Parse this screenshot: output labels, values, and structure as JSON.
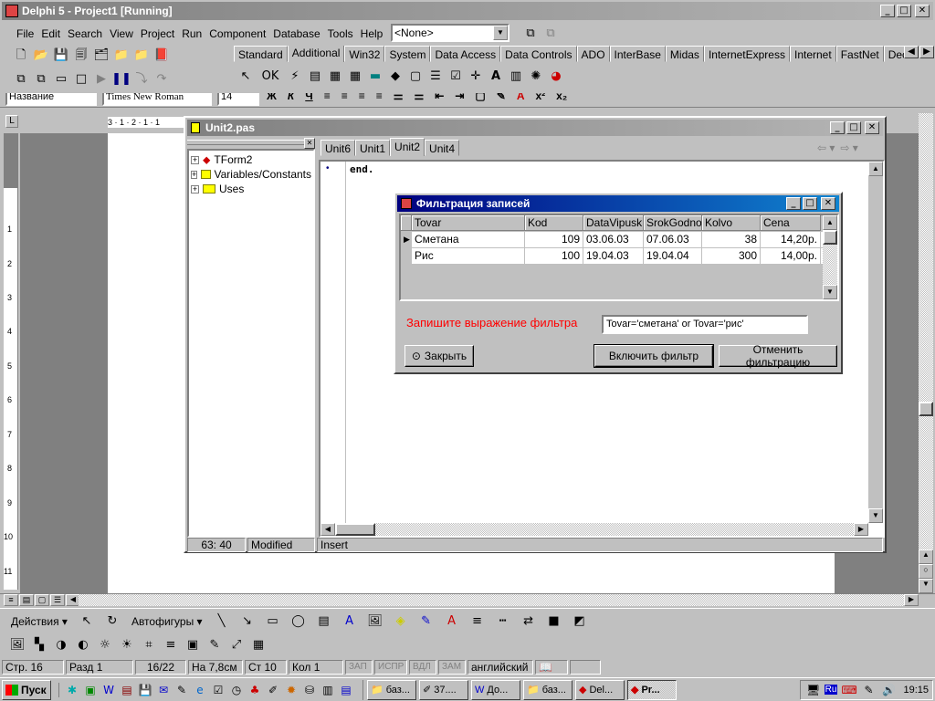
{
  "delphi": {
    "title": "Delphi 5 - Project1 [Running]",
    "menu": [
      "File",
      "Edit",
      "Search",
      "View",
      "Project",
      "Run",
      "Component",
      "Database",
      "Tools",
      "Help"
    ],
    "config_combo": "<None>",
    "palette_tabs": [
      "Standard",
      "Additional",
      "Win32",
      "System",
      "Data Access",
      "Data Controls",
      "ADO",
      "InterBase",
      "Midas",
      "InternetExpress",
      "Internet",
      "FastNet",
      "Decision C"
    ],
    "selected_tab": "Additional"
  },
  "word": {
    "style_combo": "Название",
    "font_combo": "Times New Roman",
    "size_combo": "14",
    "ruler_text": "3 · 1 · 2 · 1 · 1",
    "drawing_toolbar": {
      "actions": "Действия",
      "autoshapes": "Автофигуры"
    },
    "status": {
      "page": "Стр. 16",
      "section": "Разд 1",
      "pages": "16/22",
      "at": "На 7,8см",
      "line": "Ст 10",
      "col": "Кол 1",
      "rec": "ЗАП",
      "trk": "ИСПР",
      "ext": "ВДЛ",
      "ovr": "ЗАМ",
      "lang": "английский"
    }
  },
  "editor": {
    "title": "Unit2.pas",
    "tree": [
      "TForm2",
      "Variables/Constants",
      "Uses"
    ],
    "tabs": [
      "Unit6",
      "Unit1",
      "Unit2",
      "Unit4"
    ],
    "selected_tab": "Unit2",
    "code": "end.",
    "status": {
      "position": "63: 40",
      "modified": "Modified",
      "mode": "Insert"
    }
  },
  "dialog": {
    "title": "Фильтрация записей",
    "columns": [
      "Tovar",
      "Kod",
      "DataVipusk",
      "SrokGodnos",
      "Kolvo",
      "Cena"
    ],
    "rows": [
      [
        "Сметана",
        "109",
        "03.06.03",
        "07.06.03",
        "38",
        "14,20р."
      ],
      [
        "Рис",
        "100",
        "19.04.03",
        "19.04.04",
        "300",
        "14,00р."
      ]
    ],
    "filter_label": "Запишите выражение фильтра",
    "filter_value": "Tovar='сметана' or Tovar='рис'",
    "close_button": "Закрыть",
    "apply_button": "Включить фильтр",
    "cancel_button": "Отменить фильтрацию",
    "label_color": "#ff0000"
  },
  "taskbar": {
    "start": "Пуск",
    "tasks": [
      "баз...",
      "37....",
      "До...",
      "баз...",
      "Del...",
      "Pr..."
    ],
    "pressed_index": 5,
    "lang": "Ru",
    "clock": "19:15"
  }
}
